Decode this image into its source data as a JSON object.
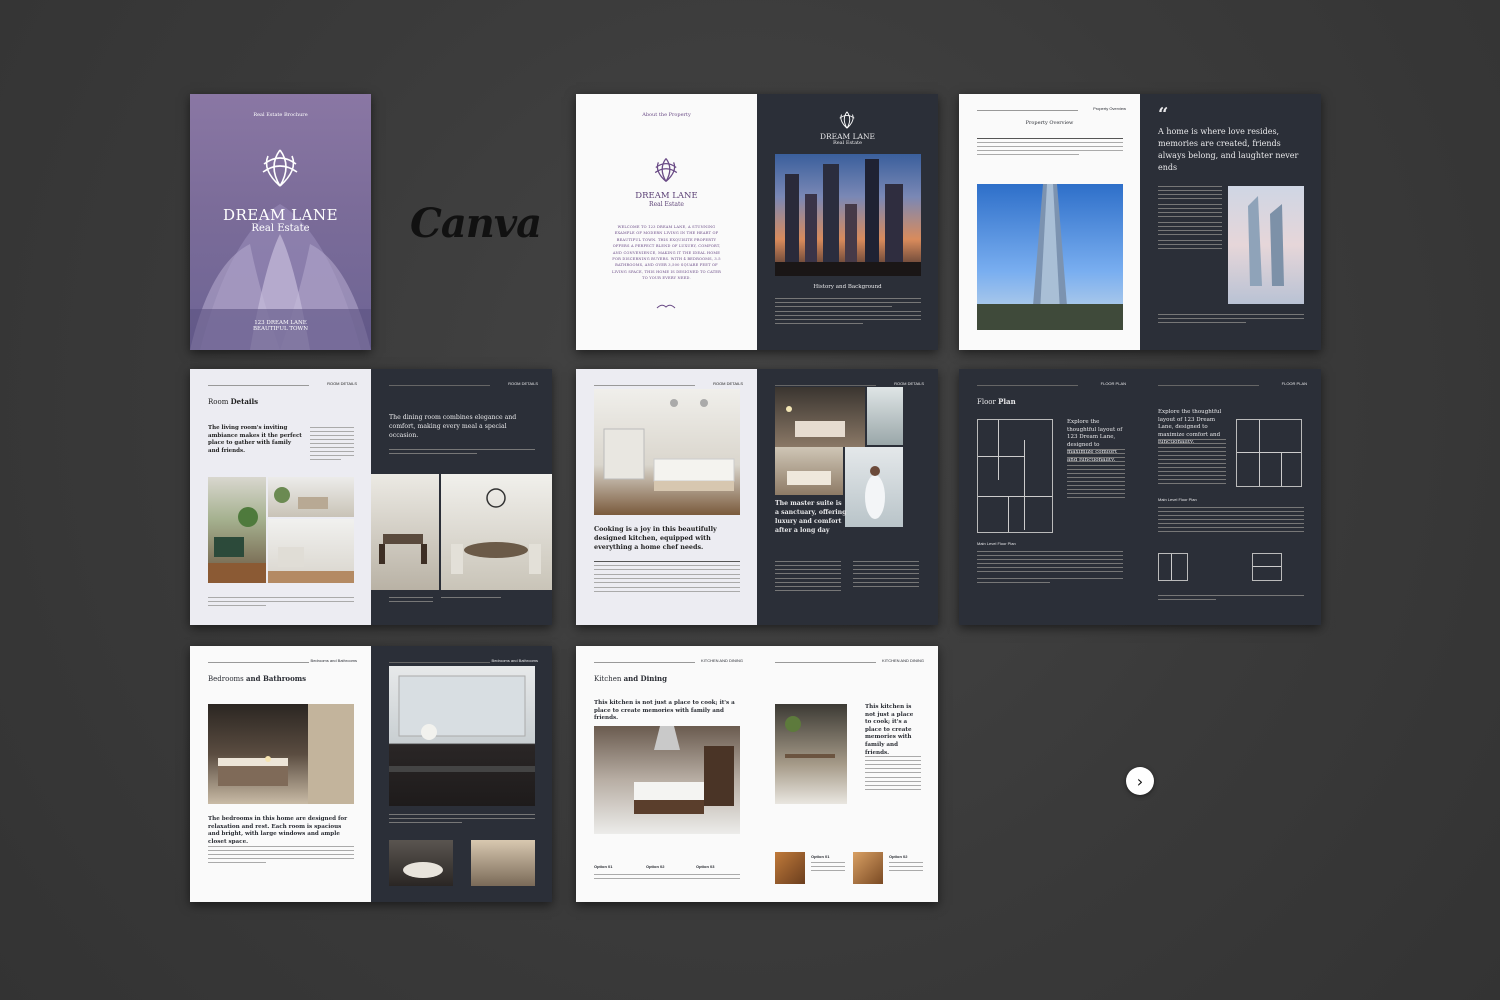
{
  "brand_mark": "Canva",
  "cover": {
    "kicker": "Real Estate Brochure",
    "title": "DREAM LANE",
    "subtitle": "Real Estate",
    "address_line1": "123 DREAM LANE",
    "address_line2": "BEAUTIFUL TOWN"
  },
  "about": {
    "heading": "About the Property",
    "logo_title": "DREAM LANE",
    "logo_subtitle": "Real Estate",
    "body": "WELCOME TO 123 DREAM LANE, A STUNNING EXAMPLE OF MODERN LIVING IN THE HEART OF BEAUTIFUL TOWN. THIS EXQUISITE PROPERTY OFFERS A PERFECT BLEND OF LUXURY, COMFORT, AND CONVENIENCE, MAKING IT THE IDEAL HOME FOR DISCERNING BUYERS. WITH 4 BEDROOMS, 3.5 BATHROOMS, AND OVER 3,500 SQUARE FEET OF LIVING SPACE, THIS HOME IS DESIGNED TO CATER TO YOUR EVERY NEED."
  },
  "history": {
    "logo_title": "DREAM LANE",
    "logo_subtitle": "Real Estate",
    "caption": "History and Background"
  },
  "overview": {
    "heading": "Property Overview",
    "quote": "A home is where love resides, memories are created, friends always belong, and laughter never ends"
  },
  "rooms": {
    "header": "ROOM DETAILS",
    "title_a": "Room ",
    "title_b": "Details",
    "lead": "The living room's inviting ambiance makes it the perfect place to gather with family and friends.",
    "dining_lead": "The dining room combines elegance and comfort, making every meal a special occasion.",
    "kitchen_lead": "Cooking is a joy in this beautifully designed kitchen, equipped with everything a home chef needs.",
    "suite_lead": "The master suite is a sanctuary, offering luxury and comfort after a long day"
  },
  "floorplan": {
    "header": "FLOOR PLAN",
    "title_a": "Floor ",
    "title_b": "Plan",
    "lead": "Explore the thoughtful layout of 123 Dream Lane, designed to maximize comfort and functionality.",
    "main_label": "Main Level Floor Plan"
  },
  "bedrooms": {
    "header": "Bedrooms and Bathrooms",
    "title_a": "Bedrooms ",
    "title_b": "and Bathrooms",
    "lead": "The bedrooms in this home are designed for relaxation and rest. Each room is spacious and bright, with large windows and ample closet space."
  },
  "kitchen": {
    "header": "KITCHEN AND DINING",
    "title_a": "Kitchen ",
    "title_b": "and Dining",
    "lead": "This kitchen is not just a place to cook; it's a place to create memories with family and friends.",
    "lead_short": "This kitchen is not just a place to cook; it's a place to create memories with family and friends.",
    "option1": "Option 01",
    "option2": "Option 02",
    "option3": "Option 03"
  },
  "colors": {
    "background": "#3b3b3b",
    "dark_page": "#2b2f38",
    "cover_purple": "#8a78a6",
    "accent": "#6a4b86"
  }
}
